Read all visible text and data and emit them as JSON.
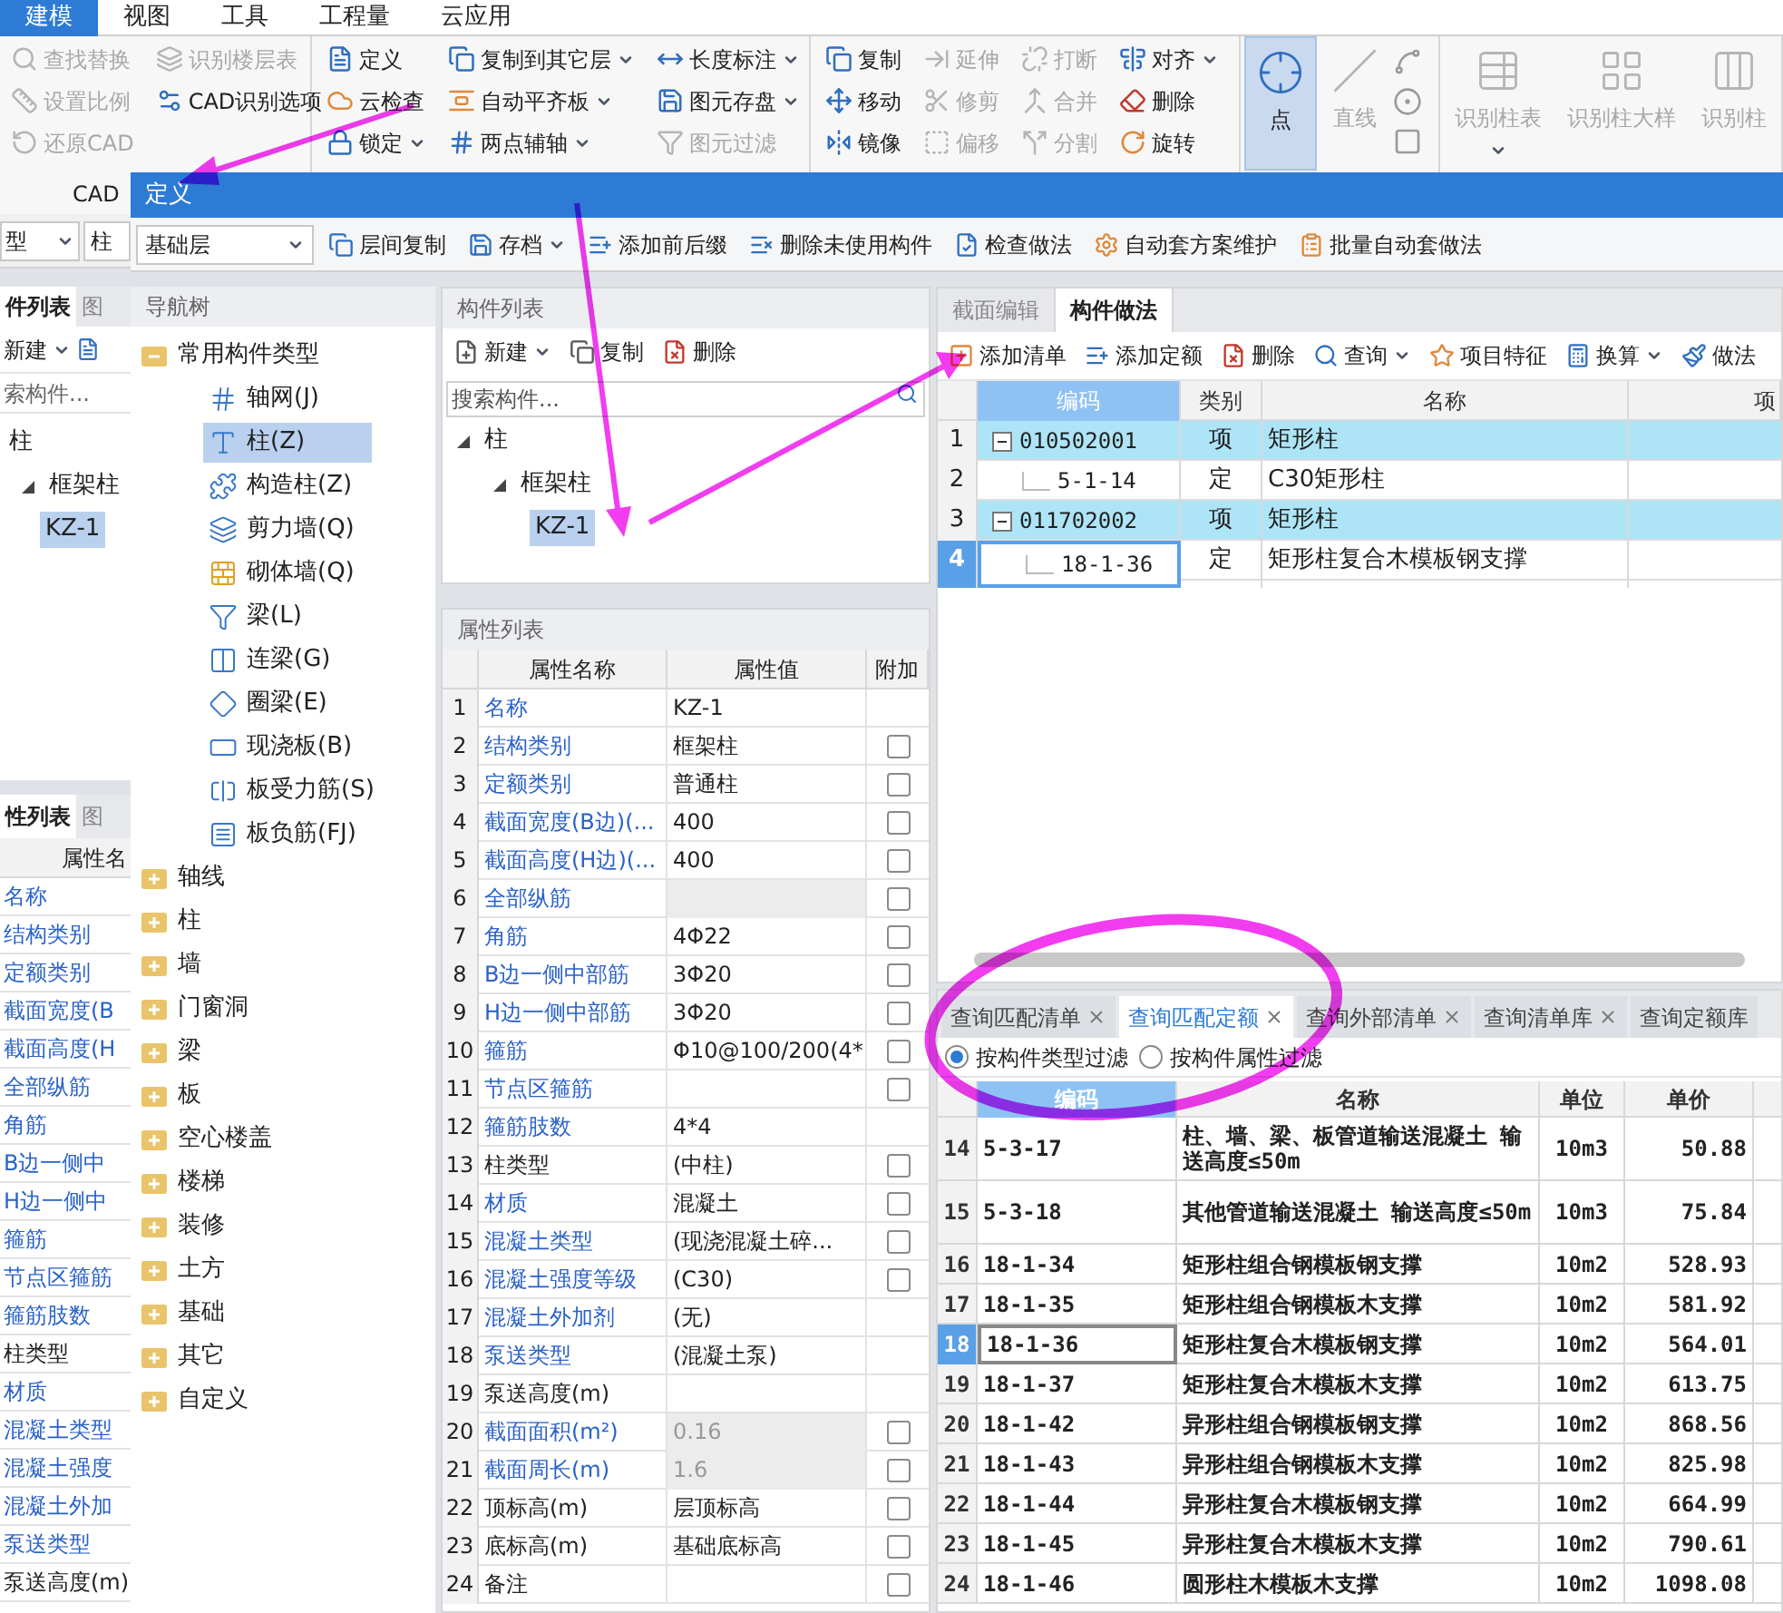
{
  "ribbon": {
    "tabs": [
      {
        "label": "建模",
        "selected": true
      },
      {
        "label": "视图",
        "selected": false
      },
      {
        "label": "工具",
        "selected": false
      },
      {
        "label": "工程量",
        "selected": false
      },
      {
        "label": "云应用",
        "selected": false
      }
    ],
    "groups": [
      {
        "kind": "small",
        "columns": [
          [
            {
              "label": "查找替换",
              "disabled": true
            },
            {
              "label": "设置比例",
              "disabled": true
            },
            {
              "label": "还原CAD",
              "disabled": true
            }
          ],
          [
            {
              "label": "识别楼层表",
              "disabled": true
            },
            {
              "label": "CAD识别选项",
              "disabled": false
            }
          ]
        ]
      },
      {
        "kind": "small",
        "columns": [
          [
            {
              "label": "定义",
              "disabled": false
            },
            {
              "label": "云检查",
              "disabled": false
            },
            {
              "label": "锁定",
              "disabled": false,
              "dropdown": true
            }
          ],
          [
            {
              "label": "复制到其它层",
              "disabled": false,
              "dropdown": true
            },
            {
              "label": "自动平齐板",
              "disabled": false,
              "dropdown": true
            },
            {
              "label": "两点辅轴",
              "disabled": false,
              "dropdown": true
            }
          ],
          [
            {
              "label": "长度标注",
              "disabled": false,
              "dropdown": true
            },
            {
              "label": "图元存盘",
              "disabled": false,
              "dropdown": true
            },
            {
              "label": "图元过滤",
              "disabled": true
            }
          ]
        ]
      },
      {
        "kind": "small",
        "columns": [
          [
            {
              "label": "复制",
              "disabled": false
            },
            {
              "label": "移动",
              "disabled": false
            },
            {
              "label": "镜像",
              "disabled": false
            }
          ],
          [
            {
              "label": "延伸",
              "disabled": true
            },
            {
              "label": "修剪",
              "disabled": true
            },
            {
              "label": "偏移",
              "disabled": true
            }
          ],
          [
            {
              "label": "打断",
              "disabled": true
            },
            {
              "label": "合并",
              "disabled": true
            },
            {
              "label": "分割",
              "disabled": true
            }
          ],
          [
            {
              "label": "对齐",
              "disabled": false,
              "dropdown": true
            },
            {
              "label": "删除",
              "disabled": false
            },
            {
              "label": "旋转",
              "disabled": false
            }
          ]
        ]
      },
      {
        "kind": "shapes",
        "buttons": [
          {
            "label": "点",
            "selected": true,
            "disabled": false
          },
          {
            "label": "直线",
            "selected": false,
            "disabled": true
          }
        ]
      },
      {
        "kind": "large",
        "buttons": [
          {
            "label": "识别柱表",
            "selected": false,
            "disabled": true,
            "dropdown": true
          },
          {
            "label": "识别柱大样",
            "selected": false,
            "disabled": true
          },
          {
            "label": "识别柱",
            "selected": false,
            "disabled": true
          }
        ]
      }
    ]
  },
  "left_panel": {
    "group_label": "CAD",
    "selects": [
      "型",
      "柱"
    ],
    "tabs": [
      {
        "label": "件列表",
        "selected": true
      },
      {
        "label": "图",
        "selected": false
      }
    ],
    "toolbar": [
      {
        "label": "新建",
        "dropdown": true
      }
    ],
    "search_placeholder": "索构件...",
    "tree": [
      {
        "label": "柱",
        "selected": false,
        "children": [
          {
            "label": "框架柱",
            "selected": false,
            "expanded": true,
            "children": [
              {
                "label": "KZ-1",
                "selected": true
              }
            ]
          }
        ]
      }
    ],
    "prop_tabs": [
      {
        "label": "性列表",
        "selected": true
      },
      {
        "label": "图",
        "selected": false
      }
    ],
    "prop_header": "属性名",
    "prop_rows": [
      {
        "name": "名称",
        "public": true
      },
      {
        "name": "结构类别",
        "public": true
      },
      {
        "name": "定额类别",
        "public": true
      },
      {
        "name": "截面宽度(B",
        "public": true
      },
      {
        "name": "截面高度(H",
        "public": true
      },
      {
        "name": "全部纵筋",
        "public": true
      },
      {
        "name": "角筋",
        "public": true
      },
      {
        "name": "B边一侧中",
        "public": true
      },
      {
        "name": "H边一侧中",
        "public": true
      },
      {
        "name": "箍筋",
        "public": true
      },
      {
        "name": "节点区箍筋",
        "public": true
      },
      {
        "name": "箍筋肢数",
        "public": true
      },
      {
        "name": "柱类型",
        "public": false
      },
      {
        "name": "材质",
        "public": true
      },
      {
        "name": "混凝土类型",
        "public": true
      },
      {
        "name": "混凝土强度",
        "public": true
      },
      {
        "name": "混凝土外加",
        "public": true
      },
      {
        "name": "泵送类型",
        "public": true
      },
      {
        "name": "泵送高度(m)",
        "public": false
      }
    ]
  },
  "dialog": {
    "title": "定义",
    "floor": "基础层",
    "toolbar": [
      {
        "label": "层间复制"
      },
      {
        "label": "存档",
        "dropdown": true
      },
      {
        "label": "添加前后缀"
      },
      {
        "label": "删除未使用构件"
      },
      {
        "label": "检查做法"
      },
      {
        "label": "自动套方案维护"
      },
      {
        "label": "批量自动套做法"
      }
    ],
    "nav_tree": {
      "title": "导航树",
      "items": [
        {
          "label": "常用构件类型",
          "expanded": true,
          "children": [
            {
              "label": "轴网(J)",
              "selected": false
            },
            {
              "label": "柱(Z)",
              "selected": true
            },
            {
              "label": "构造柱(Z)",
              "selected": false
            },
            {
              "label": "剪力墙(Q)",
              "selected": false
            },
            {
              "label": "砌体墙(Q)",
              "selected": false
            },
            {
              "label": "梁(L)",
              "selected": false
            },
            {
              "label": "连梁(G)",
              "selected": false
            },
            {
              "label": "圈梁(E)",
              "selected": false
            },
            {
              "label": "现浇板(B)",
              "selected": false
            },
            {
              "label": "板受力筋(S)",
              "selected": false
            },
            {
              "label": "板负筋(FJ)",
              "selected": false
            }
          ]
        },
        {
          "label": "轴线",
          "expanded": false
        },
        {
          "label": "柱",
          "expanded": false
        },
        {
          "label": "墙",
          "expanded": false
        },
        {
          "label": "门窗洞",
          "expanded": false
        },
        {
          "label": "梁",
          "expanded": false
        },
        {
          "label": "板",
          "expanded": false
        },
        {
          "label": "空心楼盖",
          "expanded": false
        },
        {
          "label": "楼梯",
          "expanded": false
        },
        {
          "label": "装修",
          "expanded": false
        },
        {
          "label": "土方",
          "expanded": false
        },
        {
          "label": "基础",
          "expanded": false
        },
        {
          "label": "其它",
          "expanded": false
        },
        {
          "label": "自定义",
          "expanded": false
        }
      ]
    },
    "component_list": {
      "title": "构件列表",
      "toolbar": [
        {
          "label": "新建",
          "dropdown": true
        },
        {
          "label": "复制"
        },
        {
          "label": "删除"
        }
      ],
      "search_placeholder": "搜索构件...",
      "tree": [
        {
          "label": "柱",
          "selected": false,
          "expanded": true,
          "children": [
            {
              "label": "框架柱",
              "selected": false,
              "expanded": true,
              "children": [
                {
                  "label": "KZ-1",
                  "selected": true
                }
              ]
            }
          ]
        }
      ]
    },
    "properties": {
      "title": "属性列表",
      "columns": [
        "属性名称",
        "属性值",
        "附加"
      ],
      "rows": [
        {
          "no": "1",
          "name": "名称",
          "value": "KZ-1",
          "public": true
        },
        {
          "no": "2",
          "name": "结构类别",
          "value": "框架柱",
          "public": true,
          "checked": false
        },
        {
          "no": "3",
          "name": "定额类别",
          "value": "普通柱",
          "public": true,
          "checked": false
        },
        {
          "no": "4",
          "name": "截面宽度(B边)(...",
          "value": "400",
          "public": true,
          "checked": false
        },
        {
          "no": "5",
          "name": "截面高度(H边)(...",
          "value": "400",
          "public": true,
          "checked": false
        },
        {
          "no": "6",
          "name": "全部纵筋",
          "value": "",
          "public": true,
          "readonly": true,
          "checked": false
        },
        {
          "no": "7",
          "name": "角筋",
          "value": "4Φ22",
          "public": true,
          "checked": false
        },
        {
          "no": "8",
          "name": "B边一侧中部筋",
          "value": "3Φ20",
          "public": true,
          "checked": false
        },
        {
          "no": "9",
          "name": "H边一侧中部筋",
          "value": "3Φ20",
          "public": true,
          "checked": false
        },
        {
          "no": "10",
          "name": "箍筋",
          "value": "Φ10@100/200(4*",
          "public": true,
          "checked": false
        },
        {
          "no": "11",
          "name": "节点区箍筋",
          "value": "",
          "public": true,
          "checked": false
        },
        {
          "no": "12",
          "name": "箍筋肢数",
          "value": "4*4",
          "public": true
        },
        {
          "no": "13",
          "name": "柱类型",
          "value": "(中柱)",
          "public": false,
          "checked": false
        },
        {
          "no": "14",
          "name": "材质",
          "value": "混凝土",
          "public": true,
          "checked": false
        },
        {
          "no": "15",
          "name": "混凝土类型",
          "value": "(现浇混凝土碎...",
          "public": true,
          "checked": false
        },
        {
          "no": "16",
          "name": "混凝土强度等级",
          "value": "(C30)",
          "public": true,
          "checked": false
        },
        {
          "no": "17",
          "name": "混凝土外加剂",
          "value": "(无)",
          "public": true
        },
        {
          "no": "18",
          "name": "泵送类型",
          "value": "(混凝土泵)",
          "public": true
        },
        {
          "no": "19",
          "name": "泵送高度(m)",
          "value": "",
          "public": false
        },
        {
          "no": "20",
          "name": "截面面积(m²)",
          "value": "0.16",
          "public": true,
          "readonly": true,
          "checked": false
        },
        {
          "no": "21",
          "name": "截面周长(m)",
          "value": "1.6",
          "public": true,
          "readonly": true,
          "checked": false
        },
        {
          "no": "22",
          "name": "顶标高(m)",
          "value": "层顶标高",
          "public": false,
          "checked": false
        },
        {
          "no": "23",
          "name": "底标高(m)",
          "value": "基础底标高",
          "public": false,
          "checked": false
        },
        {
          "no": "24",
          "name": "备注",
          "value": "",
          "public": false,
          "checked": false
        }
      ]
    },
    "methods": {
      "tabs": [
        {
          "label": "截面编辑",
          "selected": false
        },
        {
          "label": "构件做法",
          "selected": true
        }
      ],
      "toolbar": [
        {
          "label": "添加清单"
        },
        {
          "label": "添加定额"
        },
        {
          "label": "删除"
        },
        {
          "label": "查询",
          "dropdown": true
        },
        {
          "label": "项目特征"
        },
        {
          "label": "换算",
          "dropdown": true
        },
        {
          "label": "做法"
        }
      ],
      "columns": [
        {
          "label": "编码",
          "selected": true
        },
        {
          "label": "类别",
          "selected": false
        },
        {
          "label": "名称",
          "selected": false
        },
        {
          "label": "项",
          "selected": false
        }
      ],
      "rows": [
        {
          "no": "1",
          "code": "010502001",
          "type": "项",
          "name": "矩形柱",
          "kind": "list",
          "selected": false
        },
        {
          "no": "2",
          "code": "5-1-14",
          "type": "定",
          "name": "C30矩形柱",
          "kind": "quota",
          "selected": false
        },
        {
          "no": "3",
          "code": "011702002",
          "type": "项",
          "name": "矩形柱",
          "kind": "list",
          "selected": false
        },
        {
          "no": "4",
          "code": "18-1-36",
          "type": "定",
          "name": "矩形柱复合木模板钢支撑",
          "kind": "quota",
          "selected": true
        }
      ]
    },
    "query": {
      "tabs": [
        {
          "label": "查询匹配清单",
          "selected": false,
          "closable": true
        },
        {
          "label": "查询匹配定额",
          "selected": true,
          "closable": true
        },
        {
          "label": "查询外部清单",
          "selected": false,
          "closable": true
        },
        {
          "label": "查询清单库",
          "selected": false,
          "closable": true
        },
        {
          "label": "查询定额库",
          "selected": false,
          "closable": false
        }
      ],
      "filters": [
        {
          "label": "按构件类型过滤",
          "selected": true
        },
        {
          "label": "按构件属性过滤",
          "selected": false
        }
      ],
      "columns": [
        {
          "label": "编码",
          "selected": true
        },
        {
          "label": "名称",
          "selected": false
        },
        {
          "label": "单位",
          "selected": false
        },
        {
          "label": "单价",
          "selected": false
        }
      ],
      "rows": [
        {
          "no": "14",
          "code": "5-3-17",
          "name": "柱、墙、梁、板管道输送混凝土 输送高度≤50m",
          "unit": "10m3",
          "price": "50.88",
          "selected": false
        },
        {
          "no": "15",
          "code": "5-3-18",
          "name": "其他管道输送混凝土 输送高度≤50m",
          "unit": "10m3",
          "price": "75.84",
          "selected": false
        },
        {
          "no": "16",
          "code": "18-1-34",
          "name": "矩形柱组合钢模板钢支撑",
          "unit": "10m2",
          "price": "528.93",
          "selected": false
        },
        {
          "no": "17",
          "code": "18-1-35",
          "name": "矩形柱组合钢模板木支撑",
          "unit": "10m2",
          "price": "581.92",
          "selected": false
        },
        {
          "no": "18",
          "code": "18-1-36",
          "name": "矩形柱复合木模板钢支撑",
          "unit": "10m2",
          "price": "564.01",
          "selected": true
        },
        {
          "no": "19",
          "code": "18-1-37",
          "name": "矩形柱复合木模板木支撑",
          "unit": "10m2",
          "price": "613.75",
          "selected": false
        },
        {
          "no": "20",
          "code": "18-1-42",
          "name": "异形柱组合钢模板钢支撑",
          "unit": "10m2",
          "price": "868.56",
          "selected": false
        },
        {
          "no": "21",
          "code": "18-1-43",
          "name": "异形柱组合钢模板木支撑",
          "unit": "10m2",
          "price": "825.98",
          "selected": false
        },
        {
          "no": "22",
          "code": "18-1-44",
          "name": "异形柱复合木模板钢支撑",
          "unit": "10m2",
          "price": "664.99",
          "selected": false
        },
        {
          "no": "23",
          "code": "18-1-45",
          "name": "异形柱复合木模板木支撑",
          "unit": "10m2",
          "price": "790.61",
          "selected": false
        },
        {
          "no": "24",
          "code": "18-1-46",
          "name": "圆形柱木模板木支撑",
          "unit": "10m2",
          "price": "1098.08",
          "selected": false
        }
      ]
    }
  }
}
